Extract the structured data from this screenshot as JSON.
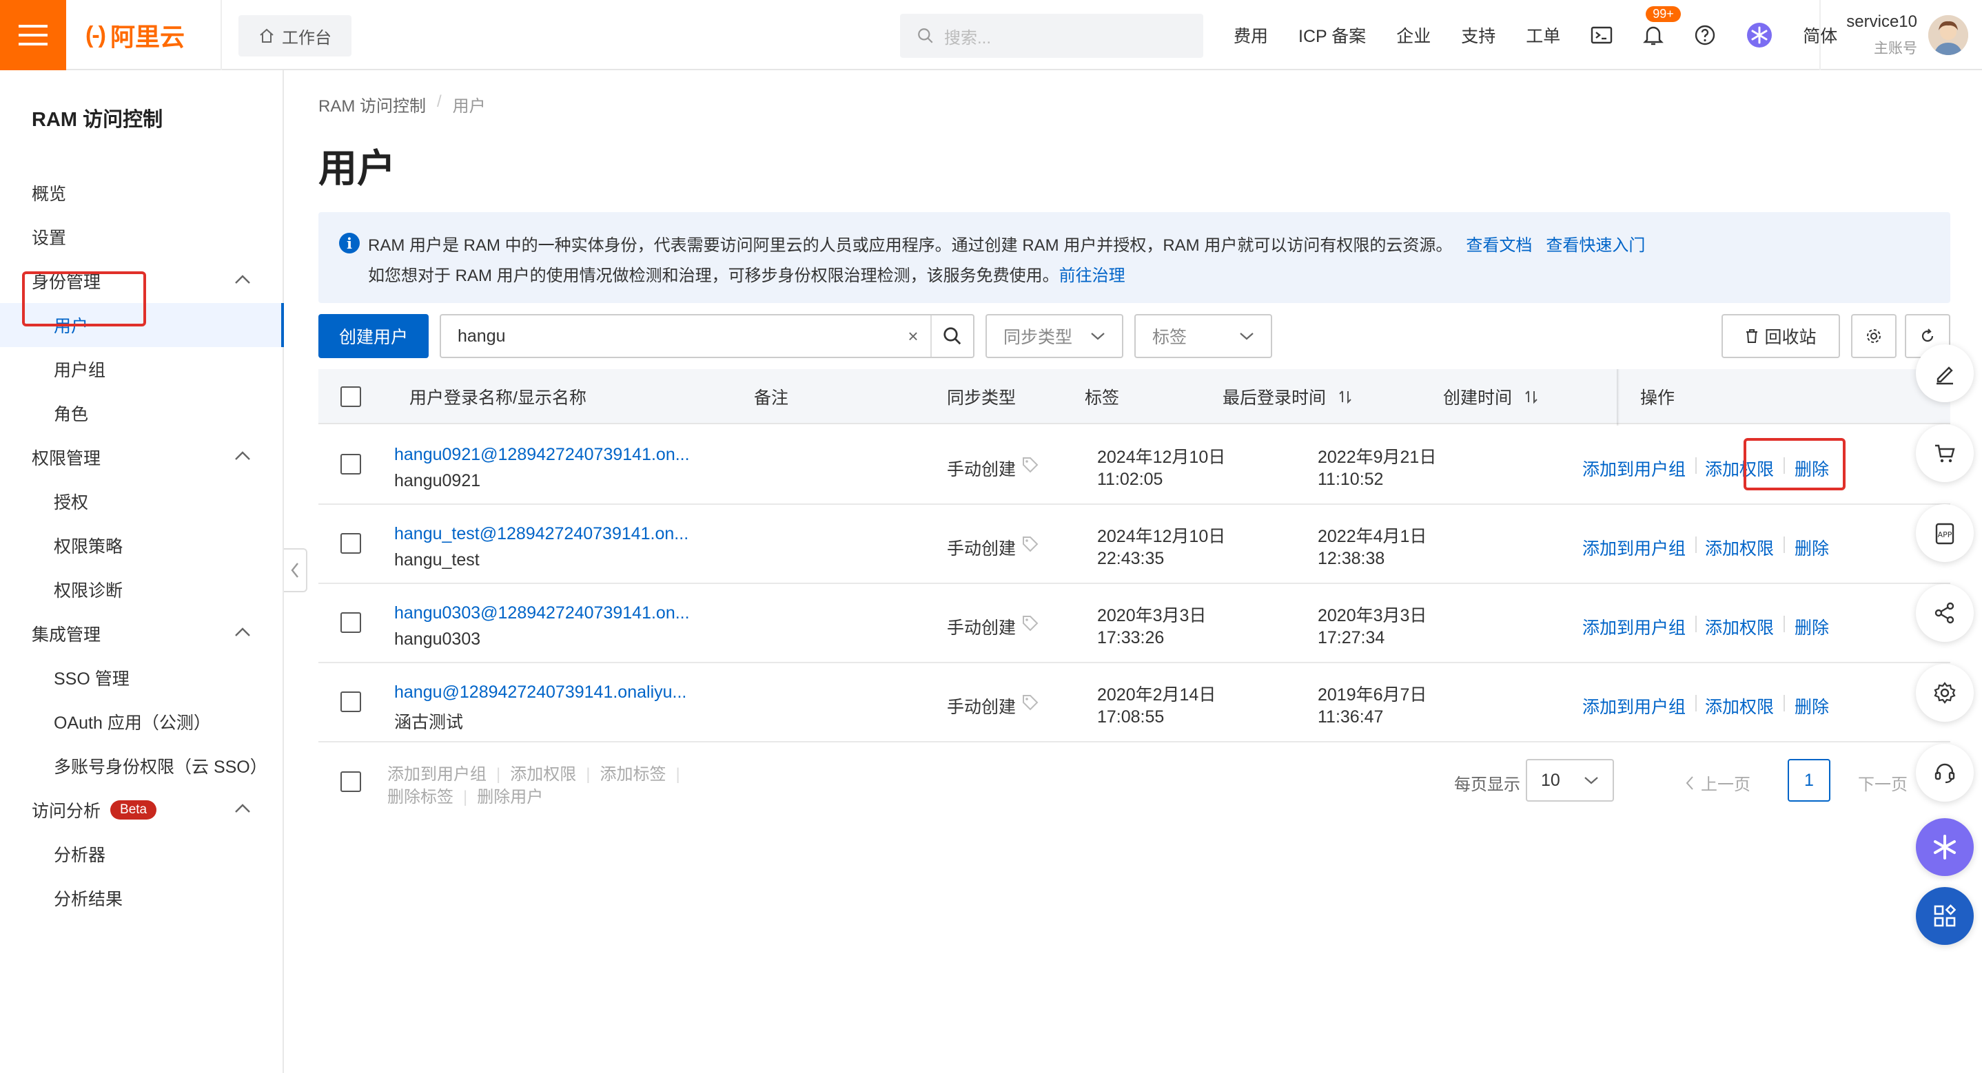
{
  "topbar": {
    "logo_text": "阿里云",
    "logo_mark": "(-)",
    "workbench": "工作台",
    "search_placeholder": "搜索...",
    "links": [
      "费用",
      "ICP 备案",
      "企业",
      "支持",
      "工单"
    ],
    "notification_badge": "99+",
    "lang": "简体",
    "user_name": "service10",
    "user_role": "主账号"
  },
  "sidebar": {
    "title": "RAM 访问控制",
    "items": [
      {
        "label": "概览"
      },
      {
        "label": "设置"
      },
      {
        "label": "身份管理"
      },
      {
        "label": "用户"
      },
      {
        "label": "用户组"
      },
      {
        "label": "角色"
      },
      {
        "label": "权限管理"
      },
      {
        "label": "授权"
      },
      {
        "label": "权限策略"
      },
      {
        "label": "权限诊断"
      },
      {
        "label": "集成管理"
      },
      {
        "label": "SSO 管理"
      },
      {
        "label": "OAuth 应用（公测）"
      },
      {
        "label": "多账号身份权限（云 SSO）"
      },
      {
        "label": "访问分析"
      },
      {
        "label": "分析器"
      },
      {
        "label": "分析结果"
      }
    ],
    "beta_badge": "Beta"
  },
  "breadcrumb": {
    "root": "RAM 访问控制",
    "sep": "/",
    "current": "用户"
  },
  "page_title": "用户",
  "info": {
    "line1": "RAM 用户是 RAM 中的一种实体身份，代表需要访问阿里云的人员或应用程序。通过创建 RAM 用户并授权，RAM 用户就可以访问有权限的云资源。",
    "link_docs": "查看文档",
    "link_quickstart": "查看快速入门",
    "line2": "如您想对于 RAM 用户的使用情况做检测和治理，可移步身份权限治理检测，该服务免费使用。",
    "link_govern": "前往治理"
  },
  "toolbar": {
    "create_user": "创建用户",
    "search_value": "hangu",
    "clear": "×",
    "sync_type": "同步类型",
    "tag": "标签",
    "recycle": "回收站"
  },
  "table": {
    "headers": {
      "name": "用户登录名称/显示名称",
      "remark": "备注",
      "sync": "同步类型",
      "tag": "标签",
      "last_login": "最后登录时间",
      "created": "创建时间",
      "ops": "操作"
    },
    "rows": [
      {
        "login": "hangu0921@1289427240739141.on...",
        "display": "hangu0921",
        "sync": "手动创建",
        "last_login_date": "2024年12月10日",
        "last_login_time": "11:02:05",
        "created_date": "2022年9月21日",
        "created_time": "11:10:52"
      },
      {
        "login": "hangu_test@1289427240739141.on...",
        "display": "hangu_test",
        "sync": "手动创建",
        "last_login_date": "2024年12月10日",
        "last_login_time": "22:43:35",
        "created_date": "2022年4月1日",
        "created_time": "12:38:38"
      },
      {
        "login": "hangu0303@1289427240739141.on...",
        "display": "hangu0303",
        "sync": "手动创建",
        "last_login_date": "2020年3月3日",
        "last_login_time": "17:33:26",
        "created_date": "2020年3月3日",
        "created_time": "17:27:34"
      },
      {
        "login": "hangu@1289427240739141.onaliyu...",
        "display": "涵古测试",
        "sync": "手动创建",
        "last_login_date": "2020年2月14日",
        "last_login_time": "17:08:55",
        "created_date": "2019年6月7日",
        "created_time": "11:36:47"
      }
    ],
    "actions": {
      "add_group": "添加到用户组",
      "add_perm": "添加权限",
      "delete": "删除"
    }
  },
  "footer": {
    "batch1": [
      "添加到用户组",
      "添加权限",
      "添加标签"
    ],
    "batch2": [
      "删除标签",
      "删除用户"
    ],
    "page_size_label": "每页显示",
    "page_size": "10",
    "prev": "上一页",
    "page": "1",
    "next": "下一页"
  },
  "colors": {
    "accent": "#ff6a00",
    "primary": "#0064c8",
    "highlight": "#e0302a"
  }
}
